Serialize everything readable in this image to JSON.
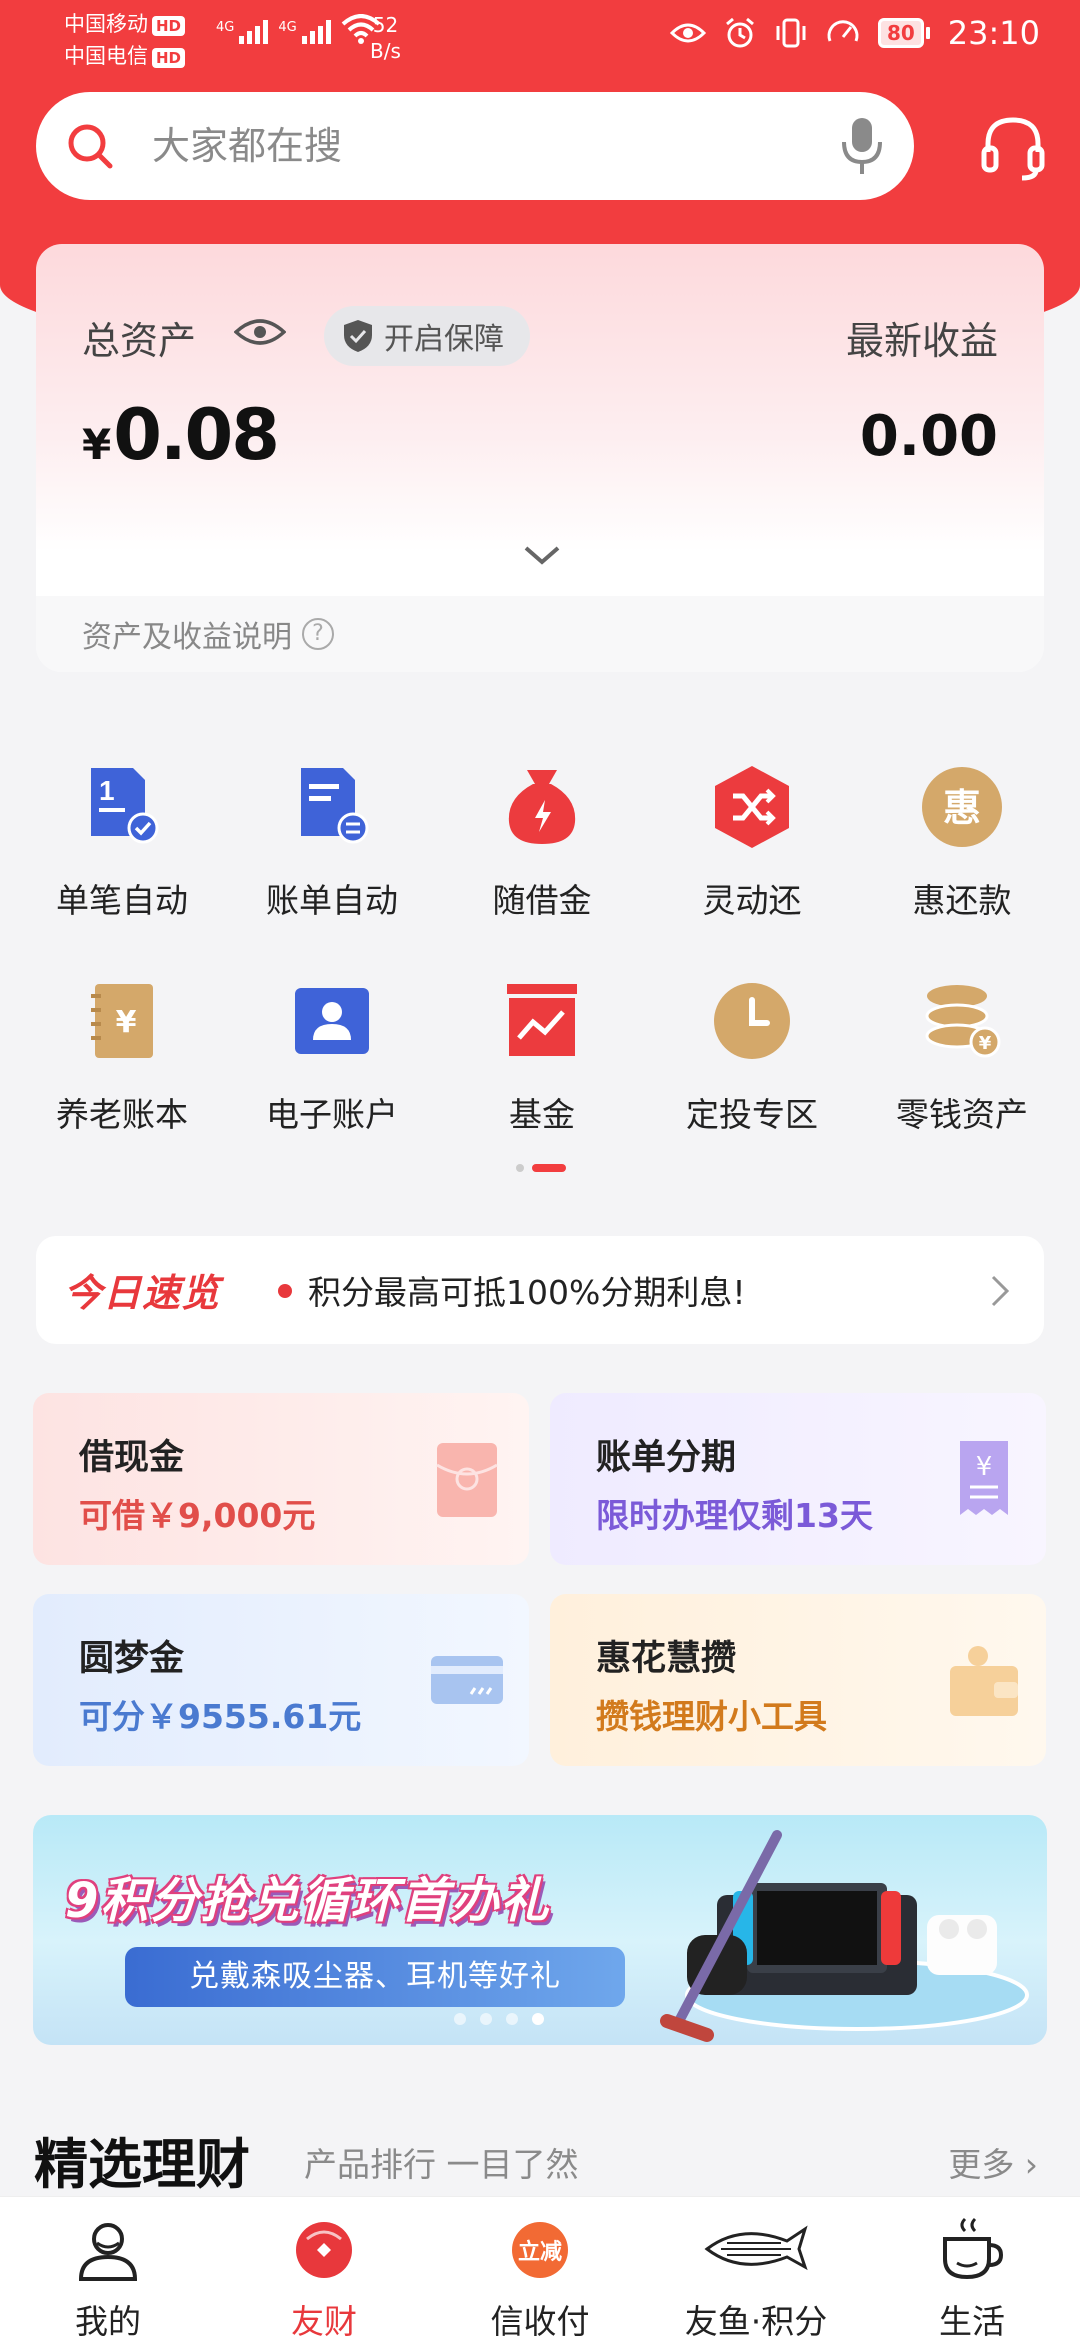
{
  "status_bar": {
    "carrier1": "中国移动",
    "carrier2": "中国电信",
    "hd": "HD",
    "net": "4G",
    "speed_value": "52",
    "speed_unit": "B/s",
    "battery": "80",
    "time": "23:10"
  },
  "search": {
    "placeholder": "大家都在搜"
  },
  "assets": {
    "title": "总资产",
    "protect_label": "开启保障",
    "latest_label": "最新收益",
    "currency": "¥",
    "total": "0.08",
    "earnings": "0.00",
    "explain": "资产及收益说明"
  },
  "services": [
    {
      "label": "单笔自动",
      "icon": "single-auto-icon"
    },
    {
      "label": "账单自动",
      "icon": "bill-auto-icon"
    },
    {
      "label": "随借金",
      "icon": "money-bag-icon"
    },
    {
      "label": "灵动还",
      "icon": "shuffle-icon"
    },
    {
      "label": "惠还款",
      "icon": "hui-coin-icon"
    },
    {
      "label": "养老账本",
      "icon": "pension-book-icon"
    },
    {
      "label": "电子账户",
      "icon": "e-account-icon"
    },
    {
      "label": "基金",
      "icon": "fund-chart-icon"
    },
    {
      "label": "定投专区",
      "icon": "clock-icon"
    },
    {
      "label": "零钱资产",
      "icon": "coin-stack-icon"
    }
  ],
  "notice": {
    "tag": "今日速览",
    "message": "积分最高可抵100%分期利息!"
  },
  "cards": [
    {
      "title": "借现金",
      "subtitle": "可借￥9,000元"
    },
    {
      "title": "账单分期",
      "subtitle": "限时办理仅剩13天"
    },
    {
      "title": "圆梦金",
      "subtitle": "可分￥9555.61元"
    },
    {
      "title": "惠花慧攒",
      "subtitle": "攒钱理财小工具"
    }
  ],
  "banner": {
    "headline": "9积分抢兑循环首办礼",
    "subline": "兑戴森吸尘器、耳机等好礼",
    "active_dot": 3
  },
  "section": {
    "title": "精选理财",
    "subtitle": "产品排行 一目了然",
    "more": "更多"
  },
  "tabs": [
    {
      "label": "我的"
    },
    {
      "label": "友财"
    },
    {
      "label": "信收付",
      "badge": "立减"
    },
    {
      "label": "友鱼·积分"
    },
    {
      "label": "生活"
    }
  ],
  "colors": {
    "brand_red": "#f23d3f",
    "gold": "#d4a86a",
    "blue": "#3f63d8"
  }
}
